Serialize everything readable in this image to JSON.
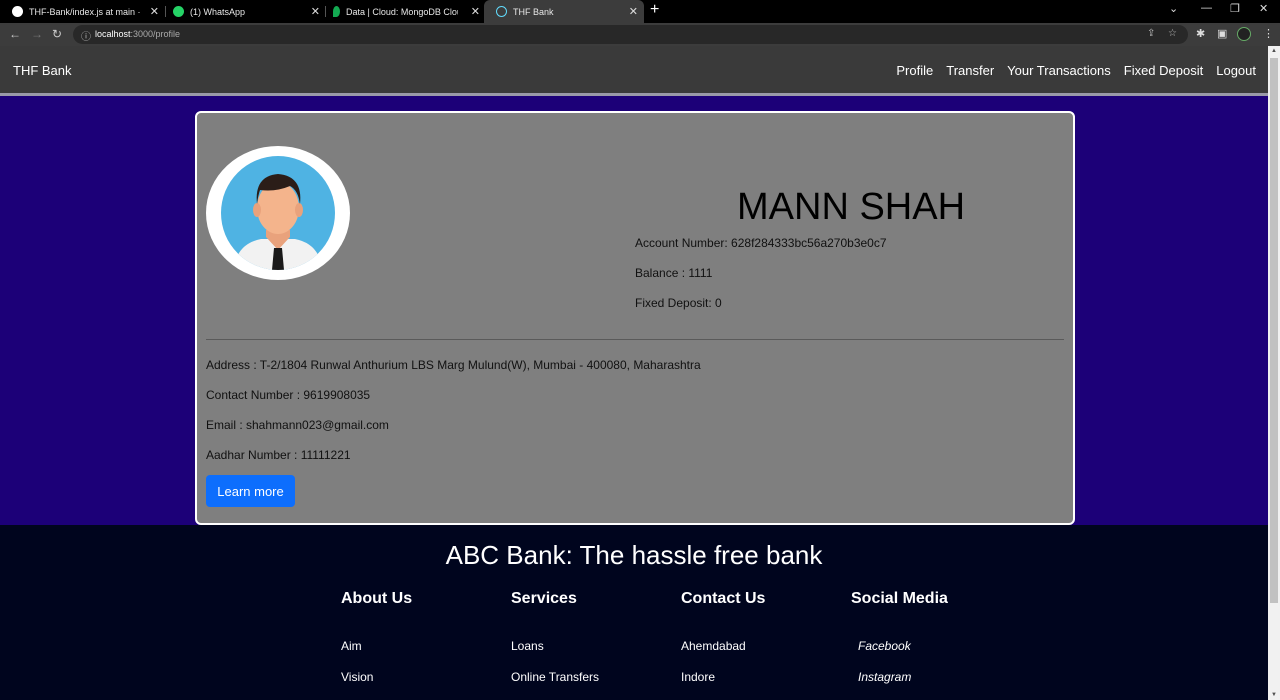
{
  "browser": {
    "tabs": [
      {
        "title": "THF-Bank/index.js at main · Parth",
        "icon": "github-icon"
      },
      {
        "title": "(1) WhatsApp",
        "icon": "whatsapp-icon"
      },
      {
        "title": "Data | Cloud: MongoDB Cloud",
        "icon": "mongodb-icon"
      },
      {
        "title": "THF Bank",
        "icon": "react-icon"
      }
    ],
    "url_host": "localhost",
    "url_path": ":3000/profile"
  },
  "navbar": {
    "brand": "THF Bank",
    "links": [
      "Profile",
      "Transfer",
      "Your Transactions",
      "Fixed Deposit",
      "Logout"
    ]
  },
  "profile": {
    "name": "MANN SHAH",
    "account": "Account Number: 628f284333bc56a270b3e0c7",
    "balance": "Balance : 1111",
    "fixed_deposit": "Fixed Deposit: 0",
    "address": "Address : T-2/1804 Runwal Anthurium LBS Marg Mulund(W), Mumbai - 400080, Maharashtra",
    "contact": "Contact Number : 9619908035",
    "email": "Email : shahmann023@gmail.com",
    "aadhar": "Aadhar Number : 11111221",
    "button": "Learn more"
  },
  "footer": {
    "title": "ABC Bank: The hassle free bank",
    "columns": [
      {
        "heading": "About Us",
        "links": [
          "Aim",
          "Vision"
        ]
      },
      {
        "heading": "Services",
        "links": [
          "Loans",
          "Online Transfers"
        ]
      },
      {
        "heading": "Contact Us",
        "links": [
          "Ahemdabad",
          "Indore"
        ]
      },
      {
        "heading": "Social Media",
        "links": [
          "Facebook",
          "Instagram"
        ]
      }
    ]
  },
  "colors": {
    "page_bg": "#1c0078",
    "card_bg": "#7f7f7f",
    "navbar_bg": "#3a3a3a",
    "footer_bg": "#00051e",
    "button_bg": "#0d6efd"
  }
}
